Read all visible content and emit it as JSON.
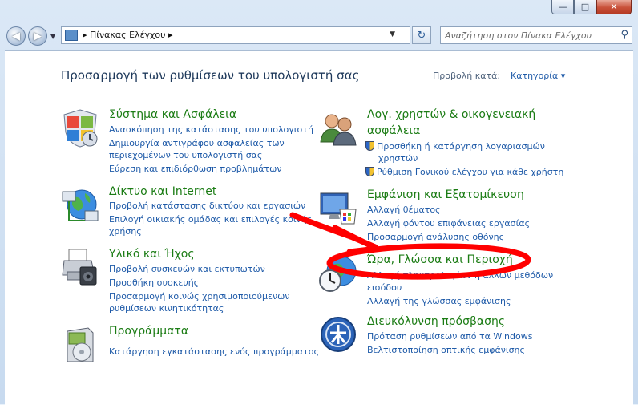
{
  "window": {
    "minimize_glyph": "—",
    "maximize_glyph": "□",
    "close_glyph": "✕"
  },
  "toolbar": {
    "back_glyph": "◀",
    "forward_glyph": "▶",
    "address_crumbs": [
      "▸",
      "Πίνακας Ελέγχου",
      "▸"
    ],
    "refresh_glyph": "↻",
    "search_placeholder": "Αναζήτηση στον Πίνακα Ελέγχου",
    "search_icon": "magnifier-icon"
  },
  "header": {
    "title": "Προσαρμογή των ρυθμίσεων του υπολογιστή σας",
    "view_by_label": "Προβολή κατά:",
    "view_by_value": "Κατηγορία ▾"
  },
  "categories": {
    "system": {
      "icon": "shield-icon",
      "title": "Σύστημα και Ασφάλεια",
      "links": [
        "Ανασκόπηση της κατάστασης του υπολογιστή",
        "Δημιουργία αντιγράφου ασφαλείας των",
        "περιεχομένων του υπολογιστή σας",
        "Εύρεση και επιδιόρθωση προβλημάτων"
      ]
    },
    "network": {
      "icon": "network-globe-icon",
      "title": "Δίκτυο και Internet",
      "links": [
        "Προβολή κατάστασης δικτύου και εργασιών",
        "Επιλογή οικιακής ομάδας και επιλογές κοινής",
        "χρήσης"
      ]
    },
    "hardware": {
      "icon": "printer-icon",
      "title": "Υλικό και Ήχος",
      "links": [
        "Προβολή συσκευών και εκτυπωτών",
        "Προσθήκη συσκευής",
        "Προσαρμογή κοινώς χρησιμοποιούμενων",
        "ρυθμίσεων κινητικότητας"
      ]
    },
    "programs": {
      "icon": "programs-icon",
      "title": "Προγράμματα",
      "links": [
        "Κατάργηση εγκατάστασης ενός προγράμματος"
      ]
    },
    "users": {
      "icon": "users-icon",
      "title": [
        "Λογ. χρηστών & οικογενειακή",
        "ασφάλεια"
      ],
      "links": [
        "Προσθήκη ή κατάργηση λογαριασμών",
        "χρηστών",
        "Ρύθμιση Γονικού ελέγχου για κάθε χρήστη"
      ]
    },
    "appearance": {
      "icon": "display-palette-icon",
      "title": "Εμφάνιση και Εξατομίκευση",
      "links": [
        "Αλλαγή θέματος",
        "Αλλαγή φόντου επιφάνειας εργασίας",
        "Προσαρμογή ανάλυσης οθόνης"
      ]
    },
    "clock": {
      "icon": "clock-globe-icon",
      "title": "Ώρα, Γλώσσα και Περιοχή",
      "links": [
        "Αλλαγή πληκτρολογίων ή άλλων μεθόδων",
        "εισόδου",
        "Αλλαγή της γλώσσας εμφάνισης"
      ]
    },
    "ease": {
      "icon": "ease-of-access-icon",
      "title": "Διευκόλυνση πρόσβασης",
      "links": [
        "Πρόταση ρυθμίσεων από τα Windows",
        "Βελτιστοποίηση οπτικής εμφάνισης"
      ]
    }
  },
  "annotation": {
    "color": "#ff0000"
  }
}
